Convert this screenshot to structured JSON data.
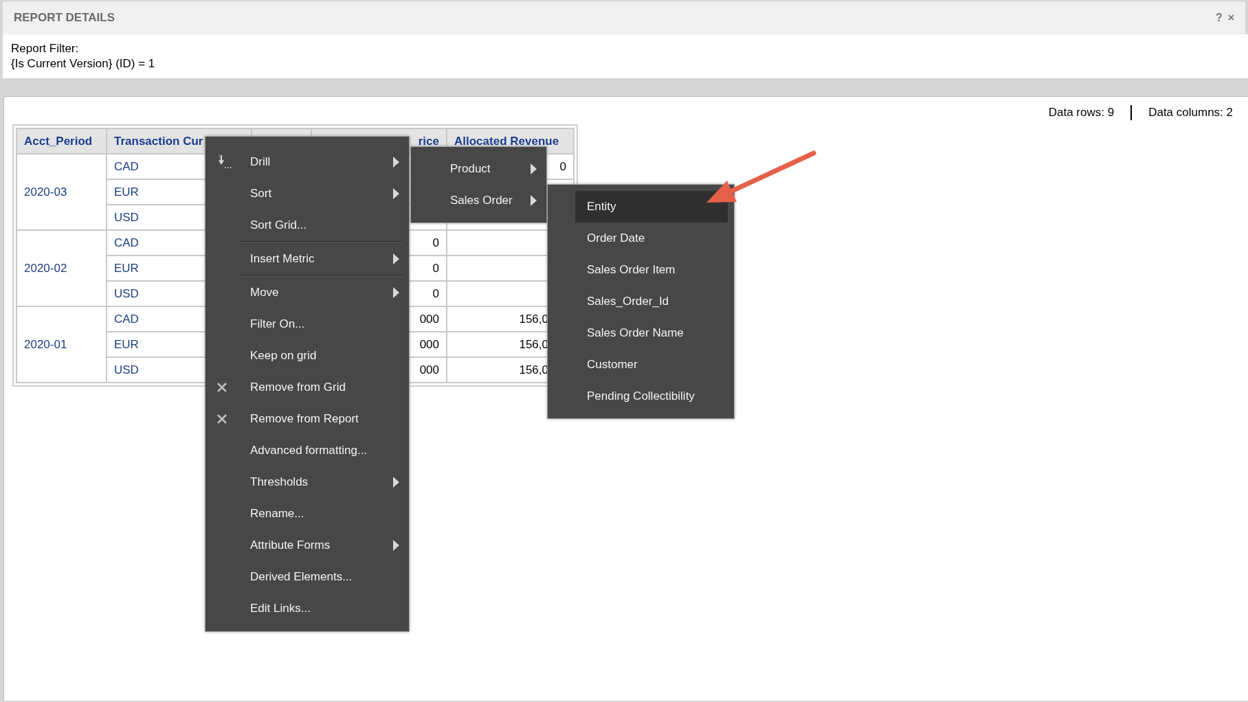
{
  "panel": {
    "title": "REPORT DETAILS",
    "help_glyph": "?",
    "close_glyph": "×",
    "filter_label": "Report Filter:",
    "filter_value": "{Is Current Version} (ID) = 1"
  },
  "summary": {
    "rows": "Data rows: 9",
    "columns": "Data columns: 2"
  },
  "table": {
    "columns": [
      "Acct_Period",
      "Transaction Cur",
      null,
      "rice",
      "Allocated Revenue"
    ],
    "groups": [
      {
        "period": "2020-03",
        "rows": [
          {
            "currency": "CAD",
            "column_5": "0"
          },
          {
            "currency": "EUR"
          },
          {
            "currency": "USD"
          }
        ]
      },
      {
        "period": "2020-02",
        "rows": [
          {
            "currency": "CAD",
            "column_4": "0"
          },
          {
            "currency": "EUR",
            "column_4": "0"
          },
          {
            "currency": "USD",
            "column_4": "0"
          }
        ]
      },
      {
        "period": "2020-01",
        "rows": [
          {
            "currency": "CAD",
            "column_4": "000",
            "column_5": "156,0"
          },
          {
            "currency": "EUR",
            "column_4": "000",
            "column_5": "156,0"
          },
          {
            "currency": "USD",
            "column_4": "000",
            "column_5": "156,0"
          }
        ]
      }
    ]
  },
  "context_menu": {
    "items": [
      {
        "kind": "drill",
        "label": "Drill",
        "submenu": true
      },
      {
        "kind": "item",
        "label": "Sort",
        "submenu": true
      },
      {
        "kind": "item",
        "label": "Sort Grid...",
        "submenu": false
      },
      {
        "kind": "separator"
      },
      {
        "kind": "item",
        "label": "Insert Metric",
        "submenu": true
      },
      {
        "kind": "separator"
      },
      {
        "kind": "item",
        "label": "Move",
        "submenu": true
      },
      {
        "kind": "item",
        "label": "Filter On...",
        "submenu": false
      },
      {
        "kind": "item",
        "label": "Keep on grid",
        "submenu": false
      },
      {
        "kind": "remove",
        "label": "Remove from Grid",
        "submenu": false
      },
      {
        "kind": "remove",
        "label": "Remove from Report",
        "submenu": false
      },
      {
        "kind": "item",
        "label": "Advanced formatting...",
        "submenu": false
      },
      {
        "kind": "item",
        "label": "Thresholds",
        "submenu": true
      },
      {
        "kind": "item",
        "label": "Rename...",
        "submenu": false
      },
      {
        "kind": "item",
        "label": "Attribute Forms",
        "submenu": true
      },
      {
        "kind": "item",
        "label": "Derived Elements...",
        "submenu": false
      },
      {
        "kind": "item",
        "label": "Edit Links...",
        "submenu": false
      }
    ]
  },
  "drill_menu": {
    "items": [
      {
        "label": "Product",
        "submenu": true
      },
      {
        "label": "Sales Order",
        "submenu": true
      }
    ]
  },
  "sales_order_menu": {
    "items": [
      {
        "label": "Entity",
        "selected": true
      },
      {
        "label": "Order Date",
        "selected": false
      },
      {
        "label": "Sales Order Item",
        "selected": false
      },
      {
        "label": "Sales_Order_Id",
        "selected": false
      },
      {
        "label": "Sales Order Name",
        "selected": false
      },
      {
        "label": "Customer",
        "selected": false
      },
      {
        "label": "Pending Collectibility",
        "selected": false
      }
    ]
  }
}
